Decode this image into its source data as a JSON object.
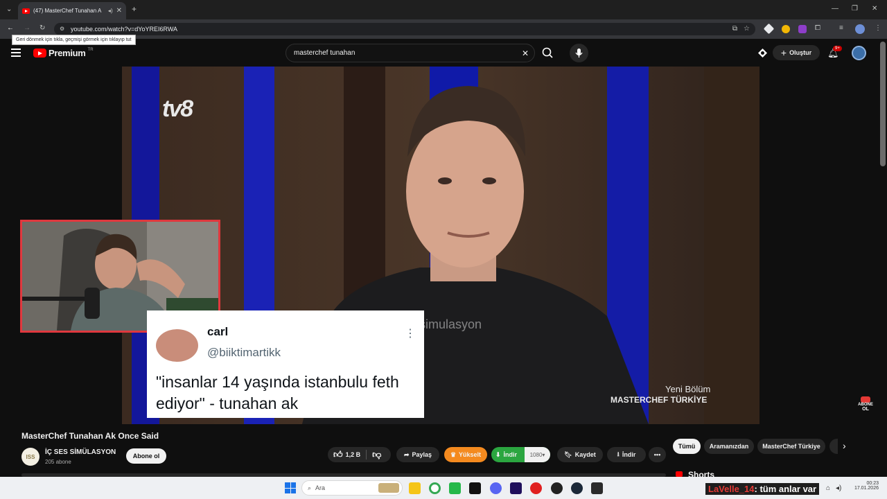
{
  "browser": {
    "tab_title": "(47) MasterChef Tunahan A",
    "url": "youtube.com/watch?v=dYoYREI6RWA",
    "back_tooltip": "Geri dönmek için tıkla, geçmişi görmek için tıklayıp tut"
  },
  "header": {
    "logo_text": "Premium",
    "logo_region": "TR",
    "search_value": "masterchef tunahan",
    "create_label": "Oluştur",
    "notif_count": "9+"
  },
  "video": {
    "watermark": "icsessimulasyon",
    "channel_logo": "tv8",
    "show_sub": "Yeni Bölüm",
    "show_title": "MASTERCHEF TÜRKİYE",
    "subscribe_badge_1": "ABONE",
    "subscribe_badge_2": "OL",
    "tweet": {
      "name": "carl",
      "handle": "@biiktimartikk",
      "text": "\"insanlar 14 yaşında istanbulu feth ediyor\" - tunahan ak"
    }
  },
  "meta": {
    "title": "MasterChef Tunahan Ak Once Said",
    "channel_initials": "ISS",
    "channel_name": "İÇ SES SİMÜLASYON",
    "subscribers": "205 abone",
    "subscribe_label": "Abone ol",
    "likes": "1,2 B",
    "share_label": "Paylaş",
    "upgrade_label": "Yükselt",
    "download_label": "İndir",
    "quality": "1080",
    "save_label": "Kaydet",
    "download2_label": "İndir"
  },
  "chips": [
    "Tümü",
    "Aramanızdan",
    "MasterChef Türkiye"
  ],
  "shorts_label": "Shorts",
  "taskbar": {
    "search_placeholder": "Ara",
    "chat_user": "LaVelle_14",
    "chat_text": ": tüm anlar var",
    "time": "00:23",
    "date": "17.01.2026"
  },
  "colors": {
    "youtube_red": "#ff0000",
    "upgrade_orange": "#f48a1f",
    "download_green": "#2ba640",
    "webcam_border": "#e0383e"
  }
}
